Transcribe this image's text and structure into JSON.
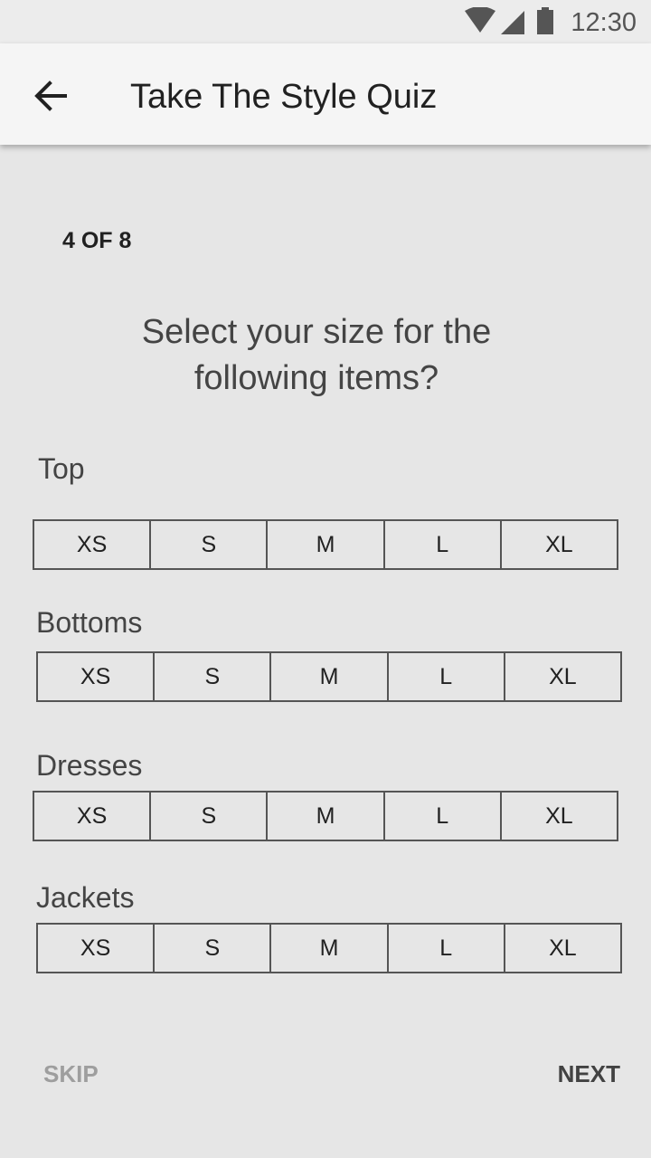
{
  "status_bar": {
    "time": "12:30",
    "icons": [
      "wifi-icon",
      "cell-signal-icon",
      "battery-icon"
    ]
  },
  "app_bar": {
    "back_icon": "arrow-back-icon",
    "title": "Take The Style Quiz"
  },
  "quiz": {
    "step": "4 OF 8",
    "question": "Select your size for the following items?",
    "categories": [
      {
        "label": "Top",
        "sizes": [
          "XS",
          "S",
          "M",
          "L",
          "XL"
        ]
      },
      {
        "label": "Bottoms",
        "sizes": [
          "XS",
          "S",
          "M",
          "L",
          "XL"
        ]
      },
      {
        "label": "Dresses",
        "sizes": [
          "XS",
          "S",
          "M",
          "L",
          "XL"
        ]
      },
      {
        "label": "Jackets",
        "sizes": [
          "XS",
          "S",
          "M",
          "L",
          "XL"
        ]
      }
    ]
  },
  "footer": {
    "skip_label": "SKIP",
    "next_label": "NEXT"
  },
  "colors": {
    "background": "#e6e6e6",
    "app_bar": "#f5f5f5",
    "skip_text": "#9e9e9e",
    "next_text": "#424242"
  }
}
